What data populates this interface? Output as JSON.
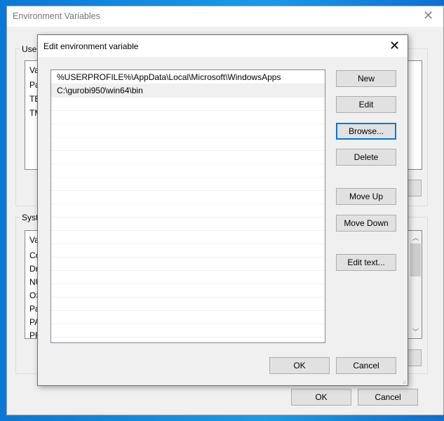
{
  "outer": {
    "title": "Environment Variables",
    "user_group": "User",
    "user_header": "Va",
    "user_rows": [
      "Pa",
      "TE",
      "TM"
    ],
    "system_group": "Syste",
    "system_header": "Va",
    "system_rows": [
      "Co",
      "Dr",
      "NU",
      "OS",
      "Pa",
      "PA",
      "PR"
    ],
    "ok": "OK",
    "cancel": "Cancel"
  },
  "dialog": {
    "title": "Edit environment variable",
    "entries": [
      "%USERPROFILE%\\AppData\\Local\\Microsoft\\WindowsApps",
      "C:\\gurobi950\\win64\\bin"
    ],
    "buttons": {
      "new": "New",
      "edit": "Edit",
      "browse": "Browse...",
      "delete": "Delete",
      "move_up": "Move Up",
      "move_down": "Move Down",
      "edit_text": "Edit text..."
    },
    "ok": "OK",
    "cancel": "Cancel"
  }
}
